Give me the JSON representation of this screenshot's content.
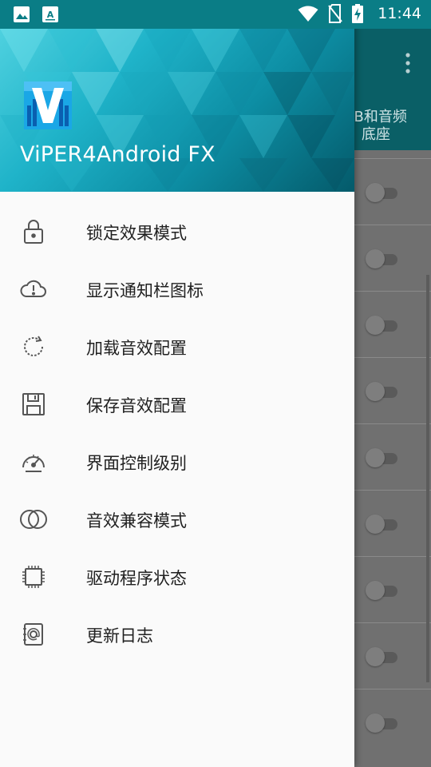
{
  "status_bar": {
    "time": "11:44",
    "left_icons": [
      "image-icon",
      "font-download-icon"
    ],
    "right_icons": [
      "wifi-icon",
      "no-sim-icon",
      "battery-charging-icon"
    ]
  },
  "background_app": {
    "tab_label": "SB和音频底座",
    "toggle_count": 9
  },
  "drawer": {
    "app_name": "ViPER4Android FX",
    "items": [
      {
        "label": "锁定效果模式",
        "icon": "lock-icon"
      },
      {
        "label": "显示通知栏图标",
        "icon": "cloud-alert-icon"
      },
      {
        "label": "加载音效配置",
        "icon": "reload-icon"
      },
      {
        "label": "保存音效配置",
        "icon": "floppy-icon"
      },
      {
        "label": "界面控制级别",
        "icon": "gauge-icon"
      },
      {
        "label": "音效兼容模式",
        "icon": "overlap-circles-icon"
      },
      {
        "label": "驱动程序状态",
        "icon": "chip-icon"
      },
      {
        "label": "更新日志",
        "icon": "contact-book-icon"
      }
    ]
  },
  "colors": {
    "accent": "#0a7d86",
    "drawer_bg": "#fafafa",
    "scrim": "#6f6f6f"
  }
}
